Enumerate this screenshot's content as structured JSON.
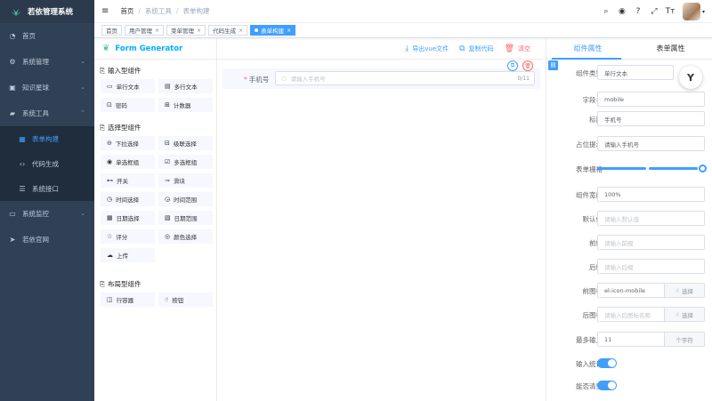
{
  "sidebar": {
    "title": "若依管理系统",
    "items": [
      {
        "label": "首页",
        "icon": "dashboard-icon"
      },
      {
        "label": "系统管理",
        "icon": "gear-icon"
      },
      {
        "label": "知识星球",
        "icon": "education-icon"
      },
      {
        "label": "系统工具",
        "icon": "toolbox-icon"
      }
    ],
    "tool_sub": [
      {
        "label": "表单构建",
        "icon": "form-icon"
      },
      {
        "label": "代码生成",
        "icon": "code-icon"
      },
      {
        "label": "系统接口",
        "icon": "sliders-icon"
      }
    ],
    "items2": [
      {
        "label": "系统监控",
        "icon": "monitor-icon"
      },
      {
        "label": "若依官网",
        "icon": "send-icon"
      }
    ],
    "expand_glyph": "⌄",
    "collapse_glyph": "⌃"
  },
  "navbar": {
    "hamburger_glyph": "≡",
    "crumbs": [
      "首页",
      "系统工具",
      "表单构建"
    ],
    "sep": "/",
    "icons": {
      "search": "⌕",
      "github": "◉",
      "help": "?",
      "fullscreen": "⤢",
      "size": "Tт"
    },
    "caret": "▾"
  },
  "tags": [
    {
      "label": "首页",
      "close": ""
    },
    {
      "label": "用户管理",
      "close": "×"
    },
    {
      "label": "菜单管理",
      "close": "×"
    },
    {
      "label": "代码生成",
      "close": "×"
    },
    {
      "label": "表单构建",
      "close": "×"
    }
  ],
  "left": {
    "title": "Form Generator",
    "leaf_glyph": "❦",
    "groups": [
      {
        "title": "输入型组件",
        "icon": "⎘",
        "items": [
          {
            "label": "单行文本",
            "icon": "▭"
          },
          {
            "label": "多行文本",
            "icon": "▤"
          },
          {
            "label": "密码",
            "icon": "⊡"
          },
          {
            "label": "计数器",
            "icon": "⊞"
          }
        ]
      },
      {
        "title": "选择型组件",
        "icon": "⎘",
        "items": [
          {
            "label": "下拉选择",
            "icon": "⊖"
          },
          {
            "label": "级联选择",
            "icon": "⊟"
          },
          {
            "label": "单选框组",
            "icon": "◉"
          },
          {
            "label": "多选框组",
            "icon": "☑"
          },
          {
            "label": "开关",
            "icon": "⊷"
          },
          {
            "label": "滑块",
            "icon": "⊸"
          },
          {
            "label": "时间选择",
            "icon": "◷"
          },
          {
            "label": "时间范围",
            "icon": "◶"
          },
          {
            "label": "日期选择",
            "icon": "▦"
          },
          {
            "label": "日期范围",
            "icon": "▧"
          },
          {
            "label": "评分",
            "icon": "☆"
          },
          {
            "label": "颜色选择",
            "icon": "◎"
          },
          {
            "label": "上传",
            "icon": "☁"
          }
        ]
      },
      {
        "title": "布局型组件",
        "icon": "⎘",
        "items": [
          {
            "label": "行容器",
            "icon": "◫"
          },
          {
            "label": "按钮",
            "icon": "☝"
          }
        ]
      }
    ]
  },
  "center": {
    "toolbar": [
      {
        "label": "导出vue文件",
        "icon": "⤓",
        "kind": "primary"
      },
      {
        "label": "复制代码",
        "icon": "⧉",
        "kind": "primary"
      },
      {
        "label": "清空",
        "icon": "🗑",
        "kind": "danger"
      }
    ],
    "field": {
      "required_mark": "*",
      "label": "手机号",
      "placeholder": "请输入手机号",
      "count": "0/11",
      "prefix_glyph": "○",
      "copy_glyph": "⧉",
      "delete_glyph": "🗑"
    }
  },
  "right": {
    "tabs": [
      "组件属性",
      "表单属性"
    ],
    "link_glyph": "⛓",
    "props": [
      {
        "label": "组件类型",
        "value": "单行文本",
        "type": "select"
      },
      {
        "label": "字段名",
        "value": "mobile",
        "type": "input"
      },
      {
        "label": "标题",
        "value": "手机号",
        "type": "input"
      },
      {
        "label": "占位提示",
        "value": "请输入手机号",
        "type": "input"
      },
      {
        "label": "表单栅格",
        "value": "",
        "type": "slider"
      },
      {
        "label": "组件宽度",
        "value": "100%",
        "type": "input"
      },
      {
        "label": "默认值",
        "value": "请输入默认值",
        "type": "ph"
      },
      {
        "label": "前缀",
        "value": "请输入前缀",
        "type": "ph"
      },
      {
        "label": "后缀",
        "value": "请输入后缀",
        "type": "ph"
      },
      {
        "label": "前图标",
        "value": "el-icon-mobile",
        "type": "icon",
        "btn": "选择"
      },
      {
        "label": "后图标",
        "value": "请输入后图标名称",
        "type": "icon-ph",
        "btn": "选择"
      },
      {
        "label": "最多输入",
        "value": "11",
        "type": "append",
        "btn": "个字符"
      },
      {
        "label": "输入统计",
        "value": "",
        "type": "switch"
      },
      {
        "label": "能否清空",
        "value": "",
        "type": "switch"
      }
    ],
    "select_glyph": "⌄",
    "btn_glyph": "☝"
  },
  "float_glyph": "Y",
  "colors": {
    "primary": "#409eff",
    "danger": "#f56c6c",
    "sidebar": "#304156"
  }
}
